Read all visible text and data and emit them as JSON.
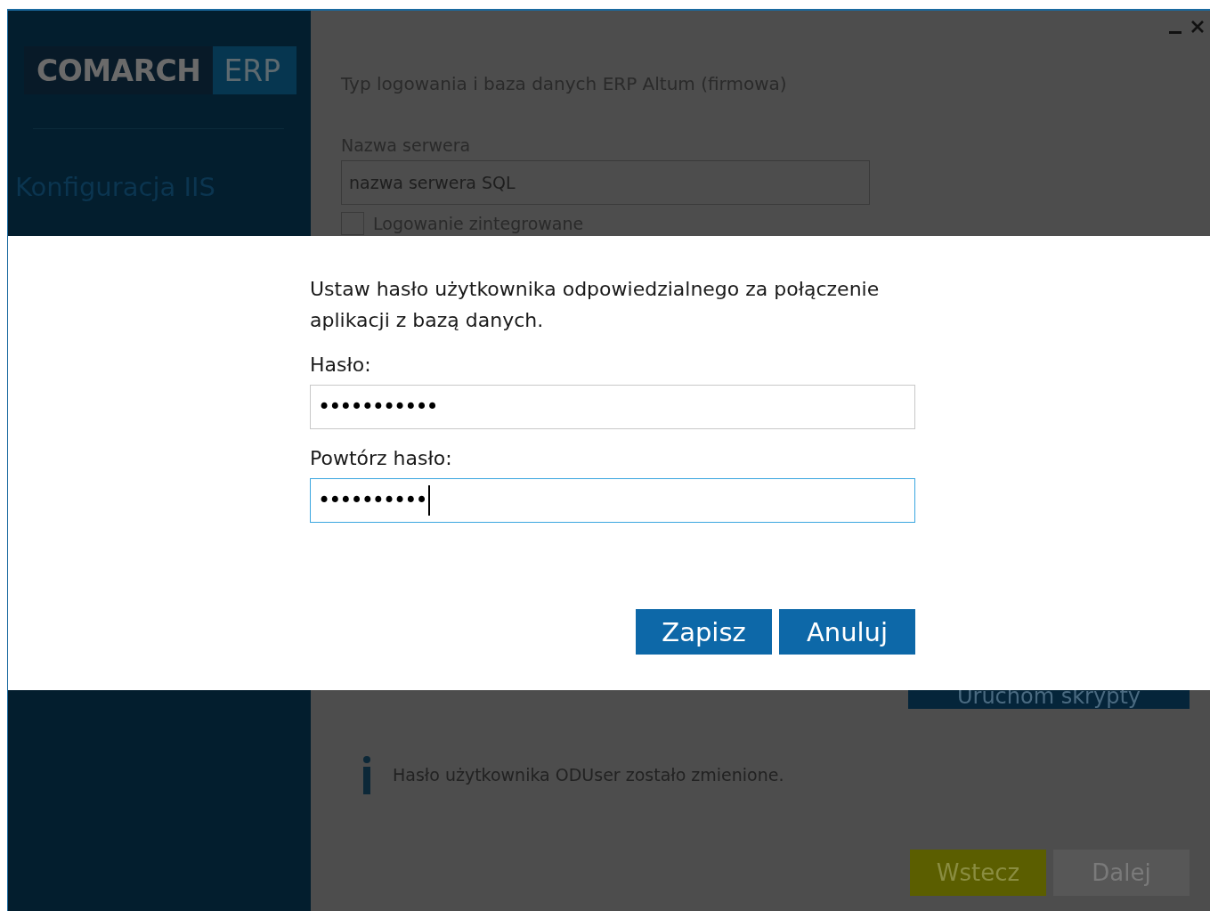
{
  "window": {
    "controls": [
      {
        "kind": "minimize"
      },
      {
        "kind": "close"
      }
    ]
  },
  "sidebar": {
    "logo": {
      "brand": "COMARCH",
      "product": "ERP"
    },
    "step": "Konfiguracja IIS"
  },
  "main": {
    "section_title": "Typ logowania i baza danych ERP Altum (firmowa)",
    "server_label": "Nazwa serwera",
    "server_value": "nazwa serwera SQL",
    "integrated_login": {
      "label": "Logowanie zintegrowane",
      "checked": false
    },
    "run_scripts_button": "Uruchom skrypty",
    "info_message": "Hasło użytkownika ODUser zostało zmienione.",
    "buttons": [
      {
        "label": "Wstecz",
        "kind": "back"
      },
      {
        "label": "Dalej",
        "kind": "next",
        "disabled": true
      }
    ]
  },
  "dialog": {
    "message": "Ustaw hasło użytkownika odpowiedzialnego za połączenie aplikacji z bazą danych.",
    "fields": [
      {
        "label": "Hasło:",
        "value": "•••••••••••",
        "focused": false
      },
      {
        "label": "Powtórz hasło:",
        "value": "••••••••••",
        "focused": true
      }
    ],
    "buttons": [
      "Zapisz",
      "Anuluj"
    ]
  }
}
